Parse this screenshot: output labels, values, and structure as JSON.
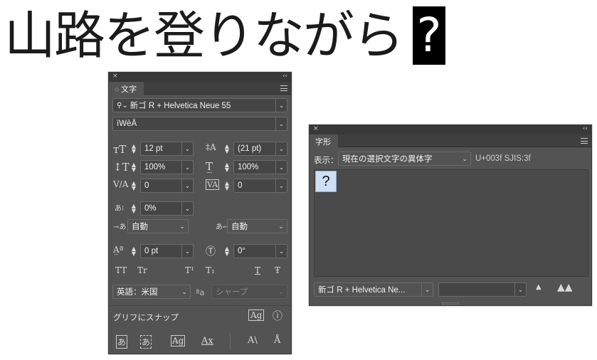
{
  "headline": {
    "text": "山路を登りながら",
    "glyph": "?"
  },
  "char_panel": {
    "close": "×",
    "collapse": "‹‹",
    "tab_label": "文字",
    "font_family": "新ゴ R + Helvetica Neue 55",
    "font_style": "ïWèÄ",
    "font_size": "12 pt",
    "leading": "(21 pt)",
    "vertical_scale": "100%",
    "horizontal_scale": "100%",
    "kerning": "0",
    "tracking": "0",
    "tsume": "0%",
    "aki_left": "自動",
    "aki_right": "自動",
    "baseline_shift": "0 pt",
    "rotation": "0°",
    "language": "英語：米国",
    "antialias": "シャープ",
    "antialias_prefix": "ªa",
    "snap_to_glyph": "グリフにスナップ",
    "style_buttons": [
      "TT",
      "Tr",
      "T¹",
      "T₁",
      "T",
      "Ŧ"
    ]
  },
  "glyph_panel": {
    "close": "×",
    "collapse": "‹‹",
    "tab_label": "字形",
    "show_label": "表示：",
    "show_value": "現在の選択文字の異体字",
    "code_info": "U+003f SJIS:3f",
    "glyph": "?",
    "font_name": "新ゴ R + Helvetica Ne..."
  }
}
